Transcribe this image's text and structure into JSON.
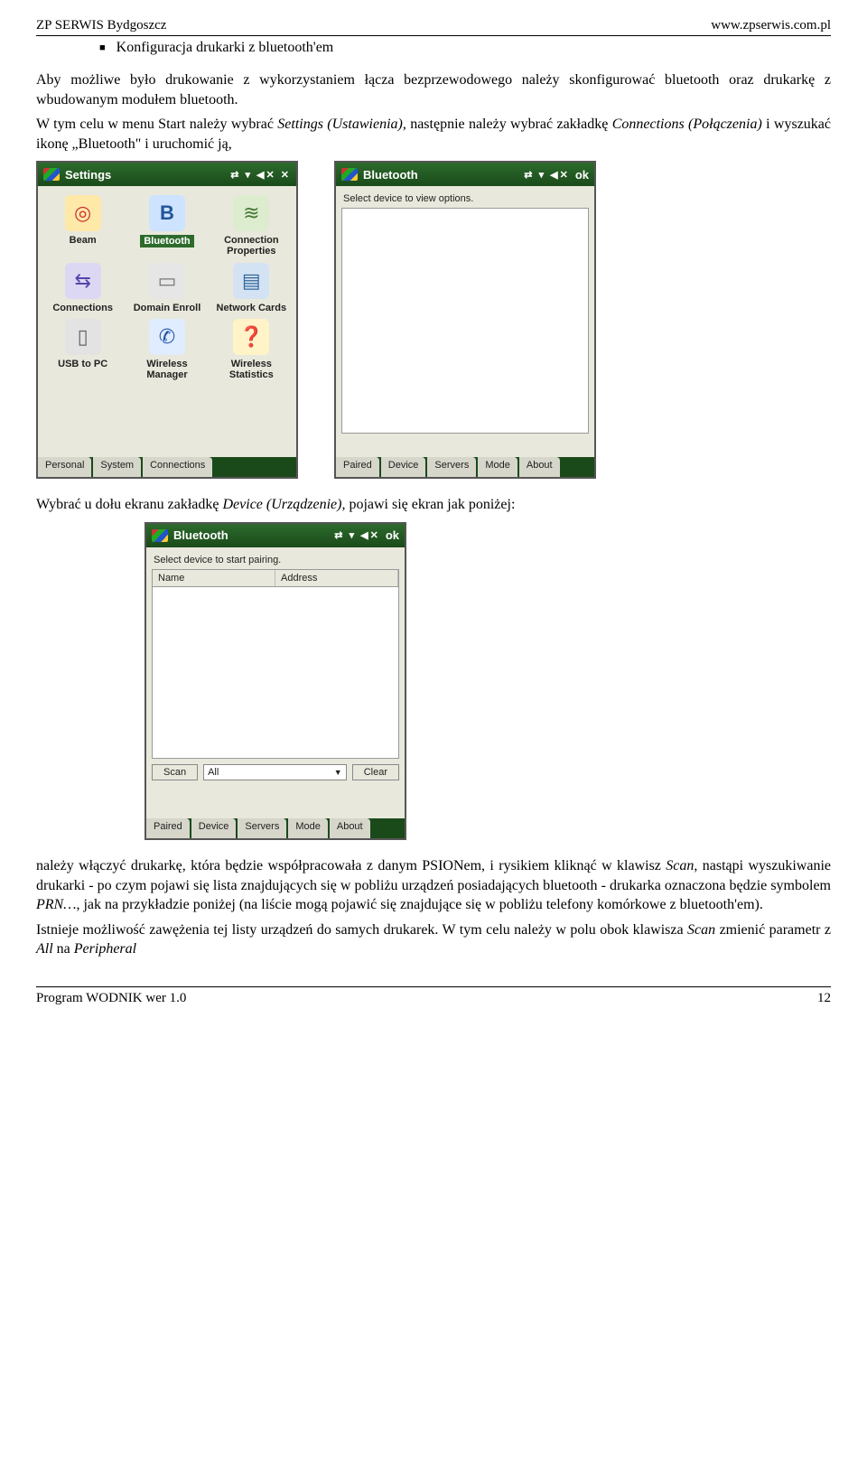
{
  "header": {
    "left": "ZP SERWIS Bydgoszcz",
    "right": "www.zpserwis.com.pl"
  },
  "bullet_title": "Konfiguracja drukarki z bluetooth'em",
  "para1": "Aby możliwe było drukowanie z wykorzystaniem łącza bezprzewodowego należy skonfigurować bluetooth oraz drukarkę z wbudowanym modułem bluetooth.",
  "para2_a": "W tym celu w menu Start należy wybrać ",
  "para2_i1": "Settings (Ustawienia),",
  "para2_b": " następnie należy wybrać zakładkę ",
  "para2_i2": "Connections (Połączenia)",
  "para2_c": " i wyszukać ikonę „Bluetooth\" i uruchomić ją,",
  "settings_screen": {
    "title": "Settings",
    "status": "⇄ ▾ ◀✕ ✕",
    "icons": [
      {
        "label": "Beam",
        "glyph": "◎"
      },
      {
        "label": "Bluetooth",
        "glyph": "B",
        "hilite": true
      },
      {
        "label": "Connection Properties",
        "glyph": "≋"
      },
      {
        "label": "Connections",
        "glyph": "⇆"
      },
      {
        "label": "Domain Enroll",
        "glyph": "▭"
      },
      {
        "label": "Network Cards",
        "glyph": "▤"
      },
      {
        "label": "USB to PC",
        "glyph": "▯"
      },
      {
        "label": "Wireless Manager",
        "glyph": "✆"
      },
      {
        "label": "Wireless Statistics",
        "glyph": "❓"
      }
    ],
    "tabs": [
      "Personal",
      "System",
      "Connections"
    ]
  },
  "bt_screen1": {
    "title": "Bluetooth",
    "status": "⇄ ▾ ◀✕",
    "ok": "ok",
    "msg": "Select device to view options.",
    "tabs": [
      "Paired",
      "Device",
      "Servers",
      "Mode",
      "About"
    ]
  },
  "caption_a": "Wybrać u dołu ekranu zakładkę ",
  "caption_i": "Device (Urządzenie),",
  "caption_b": " pojawi się ekran jak poniżej:",
  "bt_screen2": {
    "title": "Bluetooth",
    "status": "⇄ ▾ ◀✕",
    "ok": "ok",
    "msg": "Select device to start pairing.",
    "col1": "Name",
    "col2": "Address",
    "btn_scan": "Scan",
    "select_value": "All",
    "btn_clear": "Clear",
    "tabs": [
      "Paired",
      "Device",
      "Servers",
      "Mode",
      "About"
    ]
  },
  "para3_a": "należy włączyć drukarkę, która będzie współpracowała z danym PSIONem, i rysikiem kliknąć w klawisz ",
  "para3_i1": "Scan",
  "para3_b": ", nastąpi wyszukiwanie drukarki - po czym pojawi się lista znajdujących się w pobliżu urządzeń posiadających bluetooth - drukarka oznaczona będzie symbolem ",
  "para3_i2": "PRN…",
  "para3_c": ", jak na przykładzie poniżej (na liście mogą pojawić się znajdujące się w pobliżu telefony komórkowe z bluetooth'em).",
  "para4_a": "Istnieje możliwość zawężenia tej listy urządzeń do samych drukarek. W tym celu należy w polu obok klawisza ",
  "para4_i1": "Scan",
  "para4_b": " zmienić parametr z ",
  "para4_i2": "All",
  "para4_c": " na ",
  "para4_i3": "Peripheral",
  "footer": {
    "left": "Program WODNIK wer 1.0",
    "right": "12"
  }
}
